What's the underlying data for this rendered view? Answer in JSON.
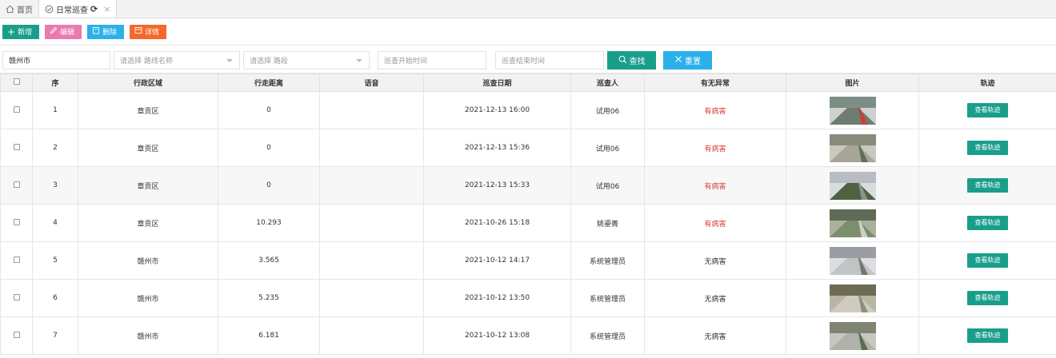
{
  "tabs": [
    {
      "label": "首页",
      "icon": "home-icon"
    },
    {
      "label": "日常巡查",
      "icon": "check-circle-icon",
      "refresh": "⟳",
      "close": "×"
    }
  ],
  "toolbar": {
    "add_label": "新增",
    "edit_label": "编辑",
    "delete_label": "删除",
    "detail_label": "详情"
  },
  "filters": {
    "region_value": "赣州市",
    "route_placeholder": "请选择 路线名称",
    "section_placeholder": "请选择 路段",
    "start_time_placeholder": "巡查开始时间",
    "end_time_placeholder": "巡查结束时间",
    "search_label": "查找",
    "reset_label": "重置"
  },
  "table": {
    "headers": [
      "序",
      "行政区域",
      "行走距离",
      "语音",
      "巡查日期",
      "巡查人",
      "有无异常",
      "图片",
      "轨迹"
    ],
    "track_label": "查看轨迹",
    "rows": [
      {
        "no": "1",
        "region": "章贡区",
        "distance": "0",
        "voice": "",
        "date": "2021-12-13 16:00",
        "inspector": "试用06",
        "status": "有病害",
        "abnormal": true
      },
      {
        "no": "2",
        "region": "章贡区",
        "distance": "0",
        "voice": "",
        "date": "2021-12-13 15:36",
        "inspector": "试用06",
        "status": "有病害",
        "abnormal": true
      },
      {
        "no": "3",
        "region": "章贡区",
        "distance": "0",
        "voice": "",
        "date": "2021-12-13 15:33",
        "inspector": "试用06",
        "status": "有病害",
        "abnormal": true
      },
      {
        "no": "4",
        "region": "章贡区",
        "distance": "10.293",
        "voice": "",
        "date": "2021-10-26 15:18",
        "inspector": "姚鎏菁",
        "status": "有病害",
        "abnormal": true
      },
      {
        "no": "5",
        "region": "赣州市",
        "distance": "3.565",
        "voice": "",
        "date": "2021-10-12 14:17",
        "inspector": "系统管理员",
        "status": "无病害",
        "abnormal": false
      },
      {
        "no": "6",
        "region": "赣州市",
        "distance": "5.235",
        "voice": "",
        "date": "2021-10-12 13:50",
        "inspector": "系统管理员",
        "status": "无病害",
        "abnormal": false
      },
      {
        "no": "7",
        "region": "赣州市",
        "distance": "6.181",
        "voice": "",
        "date": "2021-10-12 13:08",
        "inspector": "系统管理员",
        "status": "无病害",
        "abnormal": false
      }
    ]
  },
  "colors": {
    "primary": "#1a9e8c",
    "pink": "#ea7bb0",
    "blue": "#2bb0ea",
    "orange": "#f2692b",
    "danger": "#d9423d"
  }
}
